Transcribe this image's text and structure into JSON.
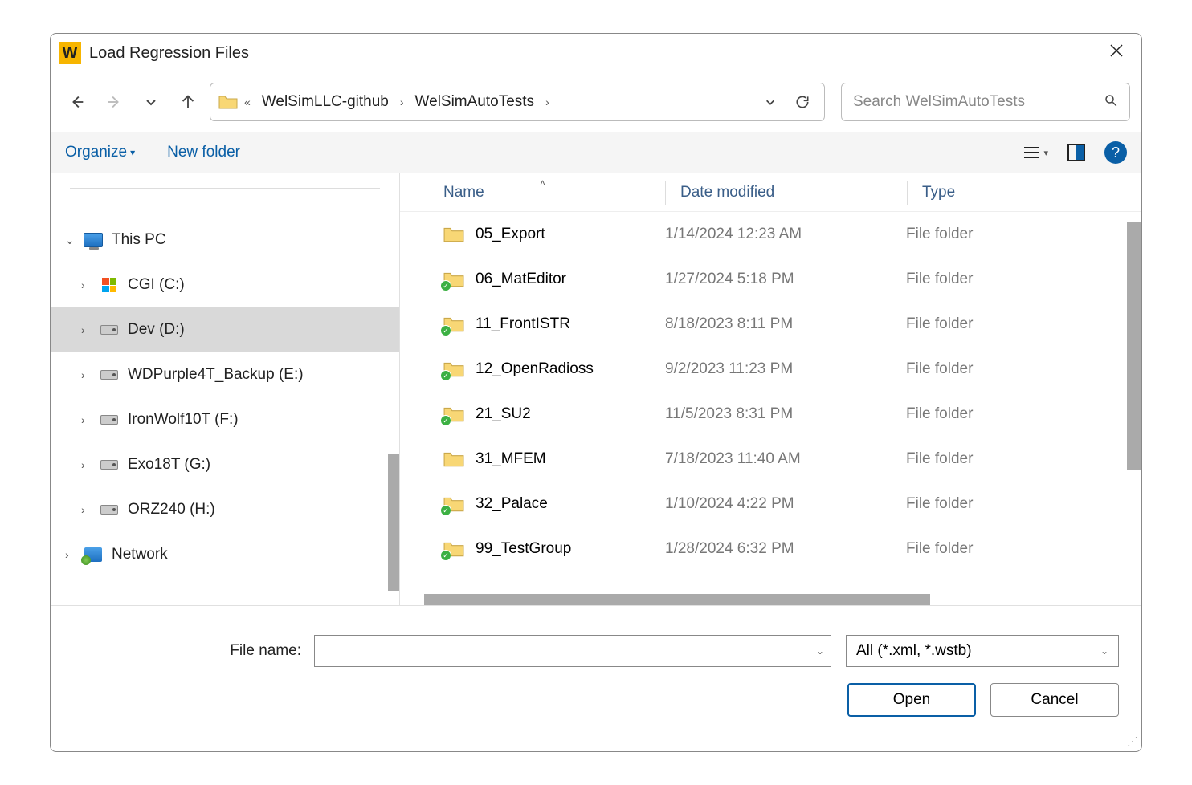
{
  "titlebar": {
    "title": "Load Regression Files"
  },
  "breadcrumb": {
    "seg1": "WelSimLLC-github",
    "seg2": "WelSimAutoTests"
  },
  "search": {
    "placeholder": "Search WelSimAutoTests"
  },
  "toolbar": {
    "organize": "Organize",
    "newfolder": "New folder"
  },
  "columns": {
    "name": "Name",
    "date": "Date modified",
    "type": "Type"
  },
  "sidebar": {
    "thispc": "This PC",
    "network": "Network",
    "drives": [
      {
        "label": "CGI (C:)",
        "special": "win"
      },
      {
        "label": "Dev (D:)",
        "selected": true
      },
      {
        "label": "WDPurple4T_Backup (E:)"
      },
      {
        "label": "IronWolf10T (F:)"
      },
      {
        "label": "Exo18T (G:)"
      },
      {
        "label": "ORZ240 (H:)"
      }
    ]
  },
  "files": [
    {
      "name": "05_Export",
      "date": "1/14/2024 12:23 AM",
      "type": "File folder",
      "sync": false
    },
    {
      "name": "06_MatEditor",
      "date": "1/27/2024 5:18 PM",
      "type": "File folder",
      "sync": true
    },
    {
      "name": "11_FrontISTR",
      "date": "8/18/2023 8:11 PM",
      "type": "File folder",
      "sync": true
    },
    {
      "name": "12_OpenRadioss",
      "date": "9/2/2023 11:23 PM",
      "type": "File folder",
      "sync": true
    },
    {
      "name": "21_SU2",
      "date": "11/5/2023 8:31 PM",
      "type": "File folder",
      "sync": true
    },
    {
      "name": "31_MFEM",
      "date": "7/18/2023 11:40 AM",
      "type": "File folder",
      "sync": false
    },
    {
      "name": "32_Palace",
      "date": "1/10/2024 4:22 PM",
      "type": "File folder",
      "sync": true
    },
    {
      "name": "99_TestGroup",
      "date": "1/28/2024 6:32 PM",
      "type": "File folder",
      "sync": true
    }
  ],
  "footer": {
    "filename_label": "File name:",
    "filename_value": "",
    "filter": "All (*.xml, *.wstb)",
    "open": "Open",
    "cancel": "Cancel"
  }
}
